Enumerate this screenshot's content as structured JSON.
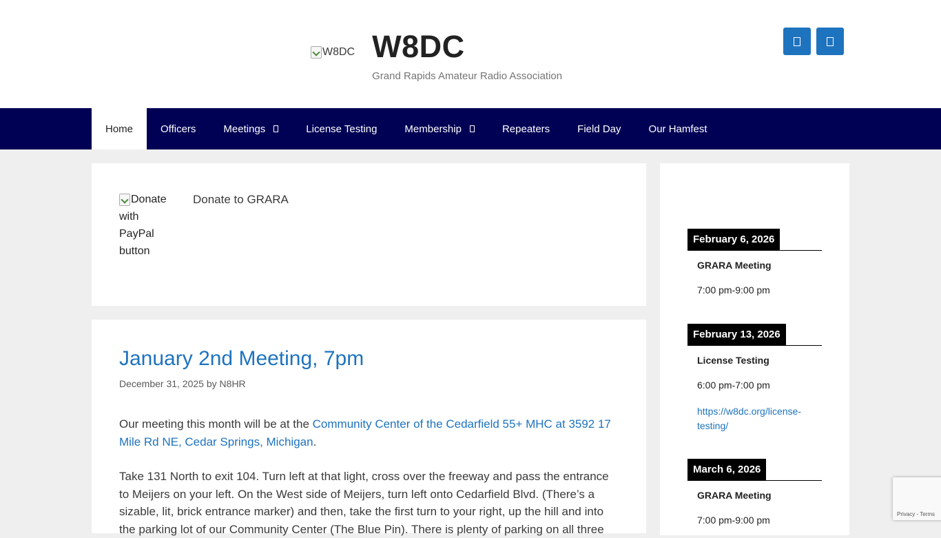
{
  "header": {
    "logo_alt": "W8DC",
    "site_title": "W8DC",
    "site_description": "Grand Rapids Amateur Radio Association",
    "social": [
      {
        "icon": "social-icon"
      },
      {
        "icon": "social-icon"
      }
    ]
  },
  "nav": {
    "items": [
      {
        "label": "Home",
        "active": true
      },
      {
        "label": "Officers"
      },
      {
        "label": "Meetings",
        "dropdown": true
      },
      {
        "label": "License Testing"
      },
      {
        "label": "Membership",
        "dropdown": true
      },
      {
        "label": "Repeaters"
      },
      {
        "label": "Field Day"
      },
      {
        "label": "Our Hamfest"
      }
    ]
  },
  "donate": {
    "button_alt": "Donate with PayPal button",
    "text": "Donate to GRARA"
  },
  "post": {
    "title": "January 2nd Meeting, 7pm",
    "date": "December 31, 2025",
    "by": "by",
    "author": "N8HR",
    "p1_before": "Our meeting this month will be at the ",
    "p1_link": "Community Center of the Cedarfield 55+ MHC at 3592 17 Mile Rd NE, Cedar Springs, Michigan",
    "p1_after": ".",
    "p2": "Take 131 North to exit 104. Turn left at that light, cross over the freeway and pass the entrance to Meijers on your left. On the West side of Meijers, turn left onto Cedarfield Blvd. (There’s a sizable, lit, brick entrance marker) and then, take the first turn to your right, up the hill and into the parking lot of our Community Center (The Blue Pin). There is plenty of parking on all three"
  },
  "events": [
    {
      "date": "February 6, 2026",
      "title": "GRARA Meeting",
      "time": "7:00 pm-9:00 pm"
    },
    {
      "date": "February 13, 2026",
      "title": "License Testing",
      "time": "6:00 pm-7:00 pm",
      "link": "https://w8dc.org/license-testing/"
    },
    {
      "date": "March 6, 2026",
      "title": "GRARA Meeting",
      "time": "7:00 pm-9:00 pm"
    }
  ],
  "recaptcha": {
    "privacy": "Privacy",
    "sep": " - ",
    "terms": "Terms"
  }
}
